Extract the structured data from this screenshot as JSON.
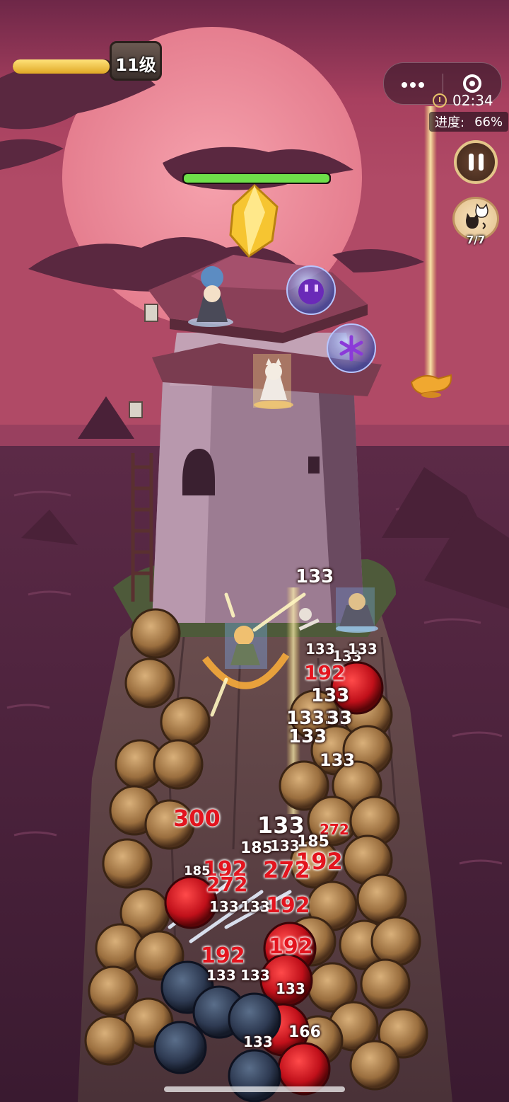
{
  "hud": {
    "level_label": "11级",
    "xp_progress": 0.98,
    "timer": "02:34",
    "progress_label": "进度:",
    "progress_value": "66%",
    "swap_count": "7/7",
    "boss_hp": 1.0
  },
  "icons": {
    "menu": "more-dots-icon",
    "close": "target-circle-icon",
    "clock": "clock-icon",
    "pause": "pause-icon",
    "swap": "cat-swap-icon",
    "lamp": "magic-lamp-icon",
    "crystal": "yellow-crystal-icon",
    "snowflake": "snowflake-bubble-icon",
    "smile": "purple-face-bubble-icon"
  },
  "colors": {
    "sky_top": "#7a2a4e",
    "sky_mid": "#c0526d",
    "moon": "#f08a98",
    "sea": "#5a2a44",
    "xp_fill": "#f2c444",
    "boss_fill": "#6ee04a",
    "damage_red": "#e3141e"
  },
  "damage": [
    {
      "text": "133",
      "red": false
    },
    {
      "text": "133",
      "red": false
    },
    {
      "text": "133",
      "red": false
    },
    {
      "text": "133",
      "red": false
    },
    {
      "text": "192",
      "red": true
    },
    {
      "text": "133",
      "red": false
    },
    {
      "text": "1333",
      "red": false
    },
    {
      "text": "33",
      "red": false
    },
    {
      "text": "133",
      "red": false
    },
    {
      "text": "133",
      "red": false
    },
    {
      "text": "272",
      "red": true
    },
    {
      "text": "300",
      "red": true
    },
    {
      "text": "133",
      "red": false
    },
    {
      "text": "185",
      "red": false
    },
    {
      "text": "133",
      "red": false
    },
    {
      "text": "185",
      "red": false
    },
    {
      "text": "192",
      "red": true
    },
    {
      "text": "272",
      "red": true
    },
    {
      "text": "192",
      "red": true
    },
    {
      "text": "272",
      "red": true
    },
    {
      "text": "185",
      "red": false
    },
    {
      "text": "133",
      "red": false
    },
    {
      "text": "133",
      "red": false
    },
    {
      "text": "192",
      "red": true
    },
    {
      "text": "192",
      "red": true
    },
    {
      "text": "192",
      "red": true
    },
    {
      "text": "133",
      "red": false
    },
    {
      "text": "133",
      "red": false
    },
    {
      "text": "133",
      "red": false
    },
    {
      "text": "133",
      "red": false
    },
    {
      "text": "166",
      "red": false
    }
  ]
}
